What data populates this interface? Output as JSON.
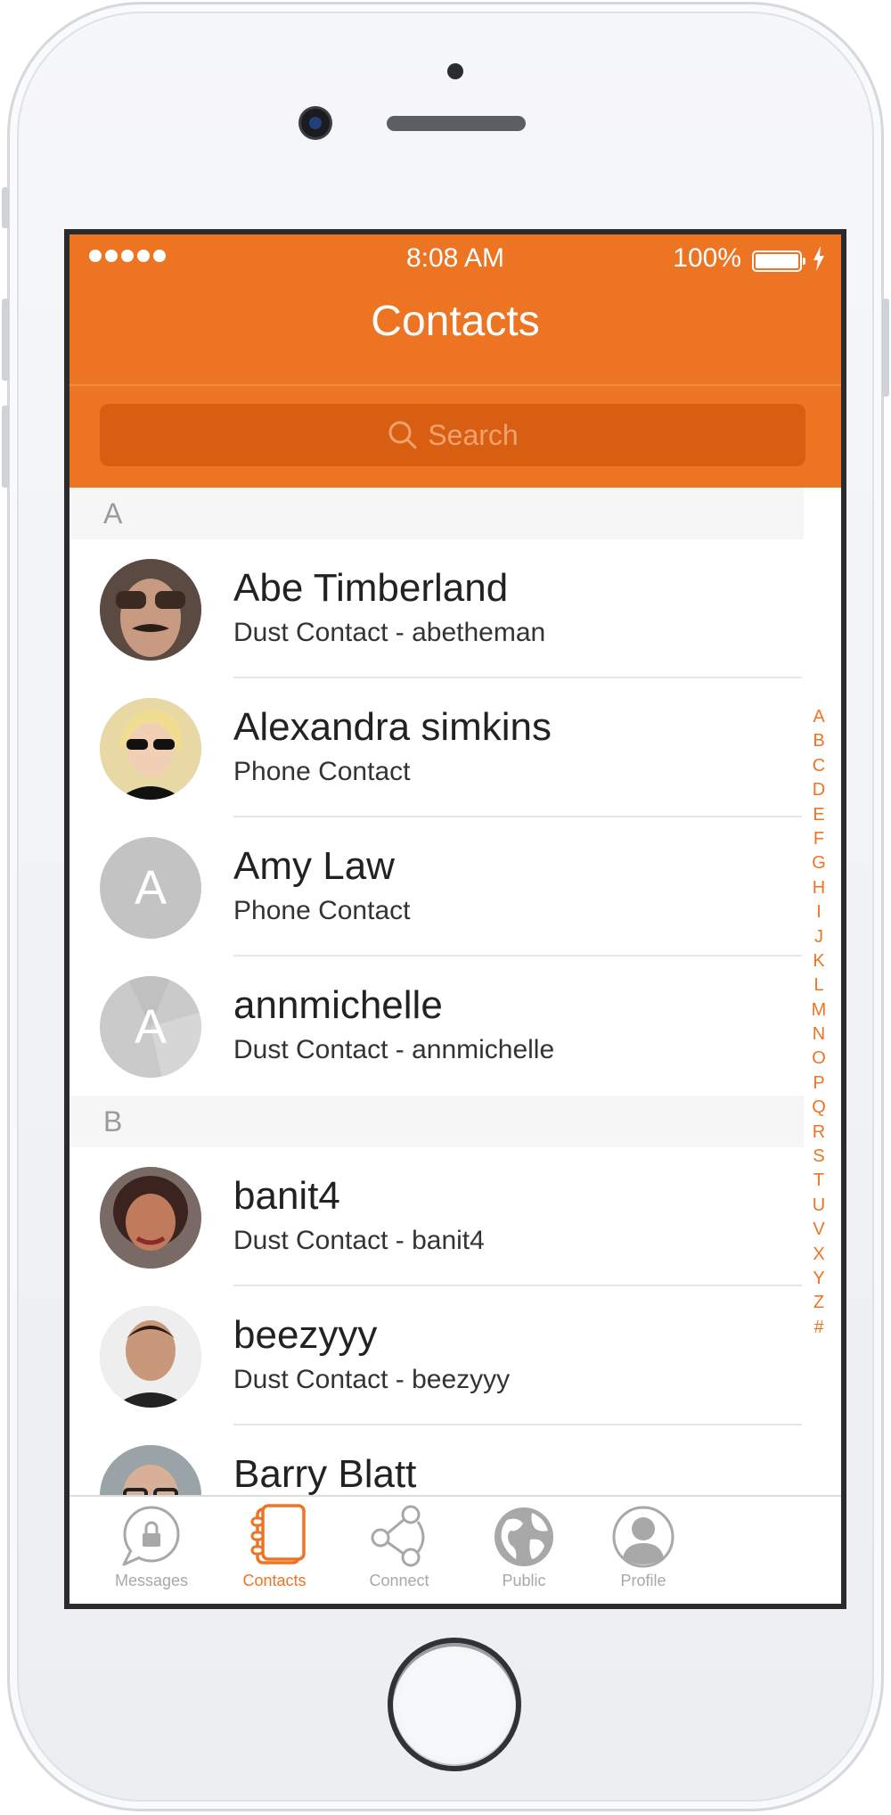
{
  "status_bar": {
    "time": "8:08 AM",
    "battery": "100%",
    "signal_icon": "signal-dots-icon",
    "battery_icon": "battery-icon",
    "charging_icon": "bolt-icon"
  },
  "header": {
    "title": "Contacts",
    "search_placeholder": "Search",
    "search_icon": "magnifier-icon"
  },
  "colors": {
    "accent": "#ed7423",
    "search_bg": "#d85e12",
    "section_bg": "#f6f6f6",
    "avatar_placeholder": "#c3c3c3"
  },
  "sections": [
    {
      "letter": "A",
      "contacts": [
        {
          "name": "Abe Timberland",
          "subtitle": "Dust Contact - abetheman",
          "avatar": "photo"
        },
        {
          "name": "Alexandra simkins",
          "subtitle": "Phone Contact",
          "avatar": "photo"
        },
        {
          "name": "Amy Law",
          "subtitle": "Phone Contact",
          "avatar": "A"
        },
        {
          "name": "annmichelle",
          "subtitle": "Dust Contact - annmichelle",
          "avatar": "A"
        }
      ]
    },
    {
      "letter": "B",
      "contacts": [
        {
          "name": "banit4",
          "subtitle": "Dust Contact - banit4",
          "avatar": "photo"
        },
        {
          "name": "beezyyy",
          "subtitle": "Dust Contact - beezyyy",
          "avatar": "photo"
        },
        {
          "name": "Barry Blatt",
          "subtitle": "",
          "avatar": "photo"
        }
      ]
    }
  ],
  "index_letters": [
    "A",
    "B",
    "C",
    "D",
    "E",
    "F",
    "G",
    "H",
    "I",
    "J",
    "K",
    "L",
    "M",
    "N",
    "O",
    "P",
    "Q",
    "R",
    "S",
    "T",
    "U",
    "V",
    "X",
    "Y",
    "Z",
    "#"
  ],
  "tabs": [
    {
      "label": "Messages",
      "icon": "lock-bubble-icon",
      "active": false
    },
    {
      "label": "Contacts",
      "icon": "address-book-icon",
      "active": true
    },
    {
      "label": "Connect",
      "icon": "share-nodes-icon",
      "active": false
    },
    {
      "label": "Public",
      "icon": "globe-icon",
      "active": false
    },
    {
      "label": "Profile",
      "icon": "person-icon",
      "active": false
    }
  ]
}
